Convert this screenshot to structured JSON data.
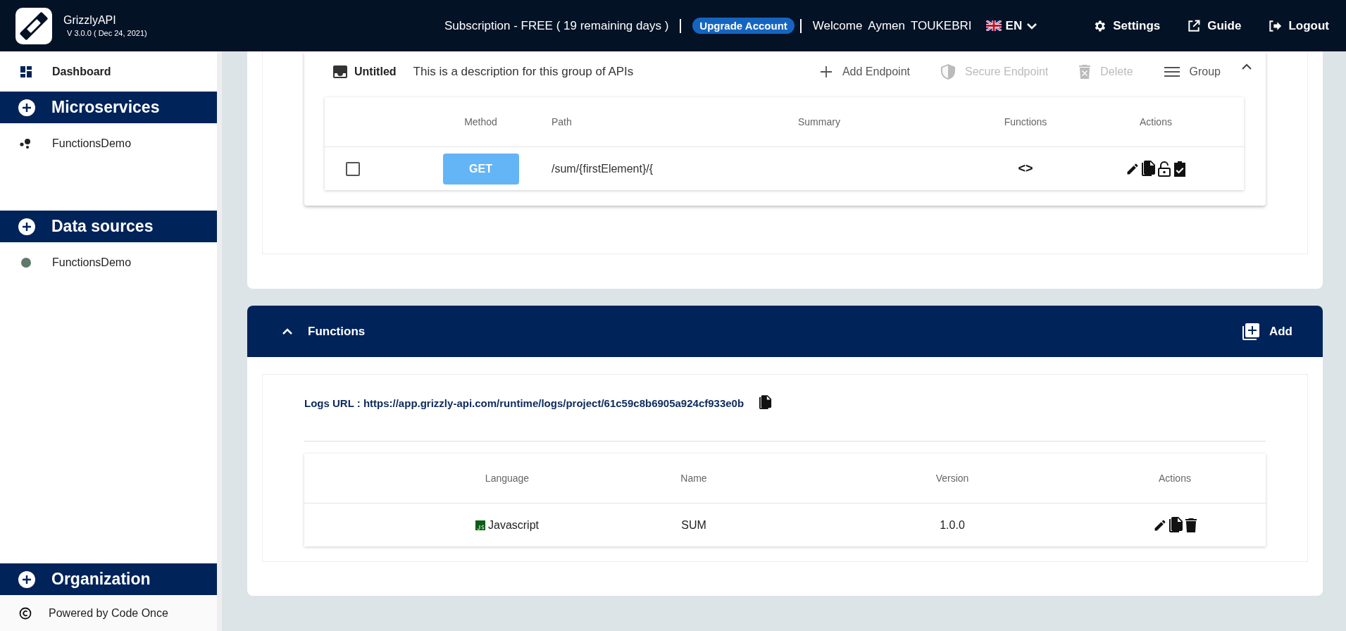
{
  "header": {
    "app_name": "GrizzlyAPI",
    "version": "V 3.0.0 ( Dec 24, 2021)",
    "subscription": "Subscription  - FREE ( 19 remaining days )",
    "upgrade_button": "Upgrade Account",
    "welcome": "Welcome",
    "user_first_name": "Aymen",
    "user_last_name": "TOUKEBRI",
    "language": "EN",
    "nav": [
      {
        "kind": "settings",
        "label": "Settings"
      },
      {
        "kind": "guide",
        "label": "Guide"
      },
      {
        "kind": "logout",
        "label": "Logout"
      }
    ]
  },
  "sidebar": {
    "dashboard": "Dashboard",
    "sections": [
      {
        "title": "Microservices",
        "items": [
          {
            "kind": "microservice",
            "label": "FunctionsDemo"
          }
        ]
      },
      {
        "title": "Data sources",
        "items": [
          {
            "kind": "datasource",
            "label": "FunctionsDemo",
            "color": "#5f7a6a"
          }
        ]
      }
    ],
    "organization": "Organization",
    "footer": "Powered by Code Once"
  },
  "group": {
    "title": "Untitled",
    "description": "This is a description for this group of APIs",
    "expanded": true,
    "actions": [
      {
        "kind": "add",
        "label": "Add Endpoint",
        "disabled": false
      },
      {
        "kind": "secure",
        "label": "Secure Endpoint",
        "disabled": true
      },
      {
        "kind": "delete",
        "label": "Delete",
        "disabled": true
      },
      {
        "kind": "group",
        "label": "Group",
        "disabled": false
      }
    ],
    "columns": [
      "Method",
      "Path",
      "Summary",
      "Functions",
      "Actions"
    ],
    "rows": [
      {
        "checked": false,
        "method": "GET",
        "color": "#64b5f6",
        "path": "/sum/{firstElement}/{",
        "functions": "<>"
      }
    ]
  },
  "functions": {
    "title": "Functions",
    "expanded": true,
    "add_button": "Add",
    "logs_url": "Logs URL : https://app.grizzly-api.com/runtime/logs/project/61c59c8b6905a924cf933e0b",
    "columns": [
      "Language",
      "Name",
      "Version",
      "Actions"
    ],
    "rows": [
      {
        "language": "Javascript",
        "name": "SUM",
        "version": "1.0.0"
      }
    ]
  }
}
